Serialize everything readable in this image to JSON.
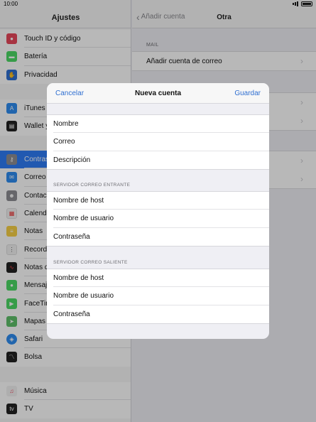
{
  "status": {
    "time": "10:00"
  },
  "left": {
    "title": "Ajustes",
    "group1": [
      {
        "label": "Touch ID y código",
        "icon": "fingerprint-icon",
        "color": "#e8475a"
      },
      {
        "label": "Batería",
        "icon": "battery-icon",
        "color": "#4cd964"
      },
      {
        "label": "Privacidad",
        "icon": "hand-icon",
        "color": "#2f6fd1"
      }
    ],
    "group2": [
      {
        "label": "iTunes",
        "icon": "app-store-icon",
        "color": "#2f8cf0"
      },
      {
        "label": "Wallet y",
        "icon": "wallet-icon",
        "color": "#222222"
      }
    ],
    "group3": [
      {
        "label": "Contras",
        "icon": "key-icon",
        "color": "#8e8e93",
        "selected": true
      },
      {
        "label": "Correo",
        "icon": "mail-icon",
        "color": "#2f8cf0"
      },
      {
        "label": "Contac",
        "icon": "contacts-icon",
        "color": "#8e8e93"
      },
      {
        "label": "Calend",
        "icon": "calendar-icon",
        "color": "#f2f2f2"
      },
      {
        "label": "Notas",
        "icon": "notes-icon",
        "color": "#f7d046"
      },
      {
        "label": "Record",
        "icon": "reminders-icon",
        "color": "#f2f2f2"
      },
      {
        "label": "Notas d",
        "icon": "voice-memos-icon",
        "color": "#222222"
      },
      {
        "label": "Mensaj",
        "icon": "messages-icon",
        "color": "#4cd964"
      },
      {
        "label": "FaceTim",
        "icon": "facetime-icon",
        "color": "#4cd964"
      },
      {
        "label": "Mapas",
        "icon": "maps-icon",
        "color": "#5fbf6a"
      },
      {
        "label": "Safari",
        "icon": "safari-icon",
        "color": "#2f8cf0"
      },
      {
        "label": "Bolsa",
        "icon": "stocks-icon",
        "color": "#222222"
      }
    ],
    "group4": [
      {
        "label": "Música",
        "icon": "music-icon",
        "color": "#f2f2f2"
      },
      {
        "label": "TV",
        "icon": "tv-icon",
        "color": "#222222"
      }
    ]
  },
  "right": {
    "back_label": "Añadir cuenta",
    "title": "Otra",
    "mail_section": "MAIL",
    "add_mail_account": "Añadir cuenta de correo"
  },
  "modal": {
    "cancel": "Cancelar",
    "title": "Nueva cuenta",
    "save": "Guardar",
    "account_fields": [
      "Nombre",
      "Correo",
      "Descripción"
    ],
    "incoming_section": "SERVIDOR CORREO ENTRANTE",
    "incoming_fields": [
      "Nombre de host",
      "Nombre de usuario",
      "Contraseña"
    ],
    "outgoing_section": "SERVIDOR CORREO SALIENTE",
    "outgoing_fields": [
      "Nombre de host",
      "Nombre de usuario",
      "Contraseña"
    ]
  }
}
